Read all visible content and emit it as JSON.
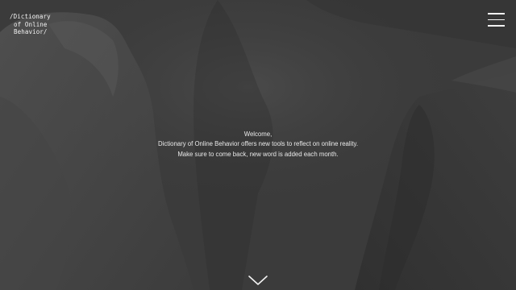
{
  "brand": {
    "line1": "/Dictionary",
    "line2": "of Online",
    "line3": "Behavior/"
  },
  "welcome": {
    "line1": "Welcome,",
    "line2": "Dictionary of Online Behavior offers new tools to reflect on online reality.",
    "line3": "Make sure to come back, new word is added each month."
  },
  "icons": {
    "menu": "hamburger-menu-icon",
    "scroll": "chevron-down-icon"
  },
  "colors": {
    "background": "#3b3b3b",
    "text": "#f2f2f2"
  }
}
